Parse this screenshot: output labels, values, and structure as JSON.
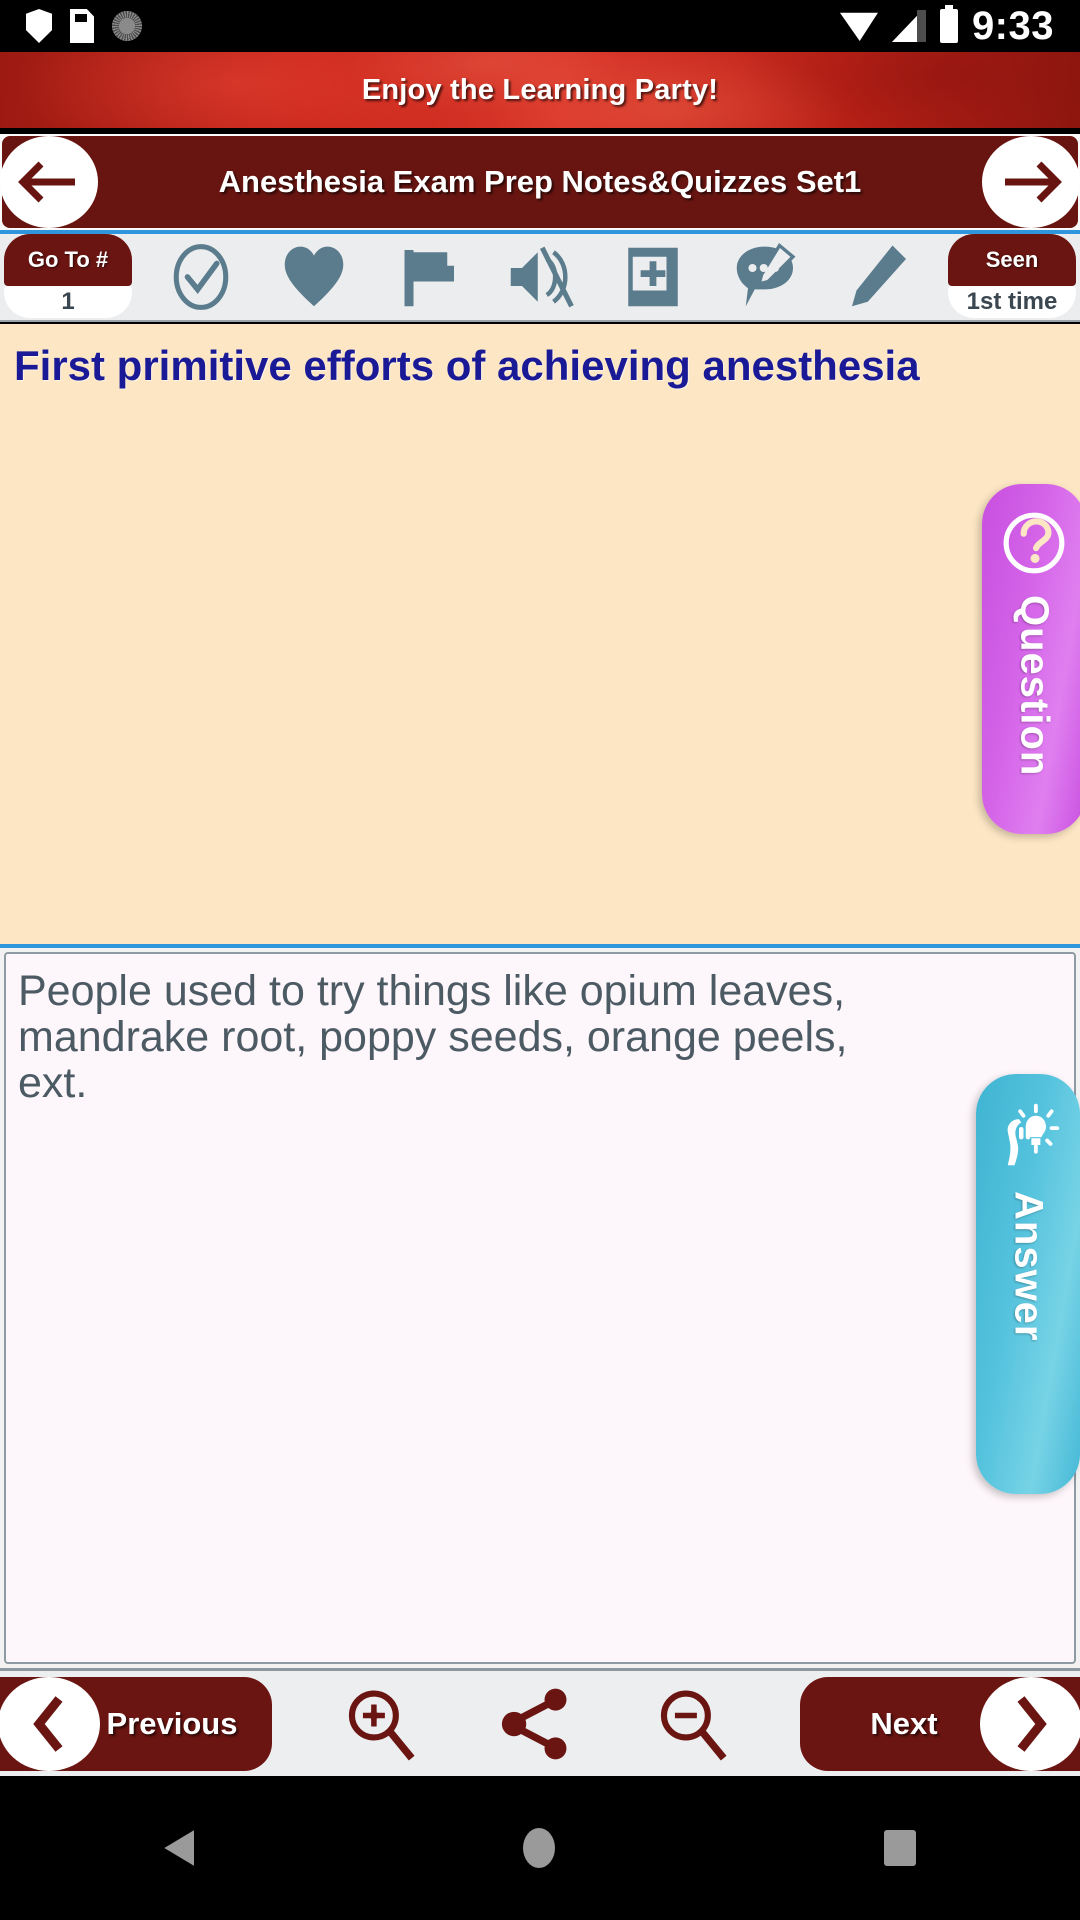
{
  "status_bar": {
    "time": "9:33",
    "icons": [
      "shield-icon",
      "sd-card-icon",
      "gear-icon",
      "wifi-icon",
      "cellular-signal-icon",
      "battery-icon"
    ]
  },
  "banner": {
    "text": "Enjoy the Learning Party!",
    "bg_color": "#c8251a"
  },
  "title_bar": {
    "title": "Anesthesia Exam Prep Notes&Quizzes Set1",
    "bg_color": "#681511",
    "back_icon": "arrow-left-icon",
    "forward_icon": "arrow-right-icon"
  },
  "toolbar": {
    "goto_label": "Go To #",
    "goto_value": "1",
    "seen_label": "Seen",
    "seen_value": "1st time",
    "accent_color": "#6b1512",
    "icon_color": "#5b7c8d",
    "items": [
      {
        "name": "mark-done-icon",
        "label": "check-circle"
      },
      {
        "name": "favorite-heart-icon",
        "label": "heart"
      },
      {
        "name": "flag-icon",
        "label": "flag"
      },
      {
        "name": "mute-speaker-icon",
        "label": "volume-off"
      },
      {
        "name": "add-to-list-icon",
        "label": "add-note"
      },
      {
        "name": "comment-edit-icon",
        "label": "annotate"
      },
      {
        "name": "pencil-icon",
        "label": "edit"
      }
    ]
  },
  "question_card": {
    "tab_label": "Question",
    "tab_icon": "question-mark-icon",
    "tab_color": "#d464e8",
    "bg_color": "#fce6c4",
    "text_color": "#1a1a96",
    "text": "First primitive efforts of achieving anesthesia"
  },
  "answer_card": {
    "tab_label": "Answer",
    "tab_icon": "hand-lightbulb-icon",
    "tab_color": "#54c2dd",
    "bg_color": "#fdf6fa",
    "text_color": "#4c5a64",
    "text": "People used to try things like opium leaves, mandrake root, poppy seeds, orange peels, ext."
  },
  "bottom_bar": {
    "previous_label": "Previous",
    "next_label": "Next",
    "previous_icon": "chevron-left-icon",
    "next_icon": "chevron-right-icon",
    "zoom_in_icon": "magnifier-plus-icon",
    "share_icon": "share-icon",
    "zoom_out_icon": "magnifier-minus-icon",
    "accent_color": "#6b1512"
  },
  "android_nav": {
    "back": "back-triangle-icon",
    "home": "home-circle-icon",
    "recents": "recents-square-icon"
  }
}
